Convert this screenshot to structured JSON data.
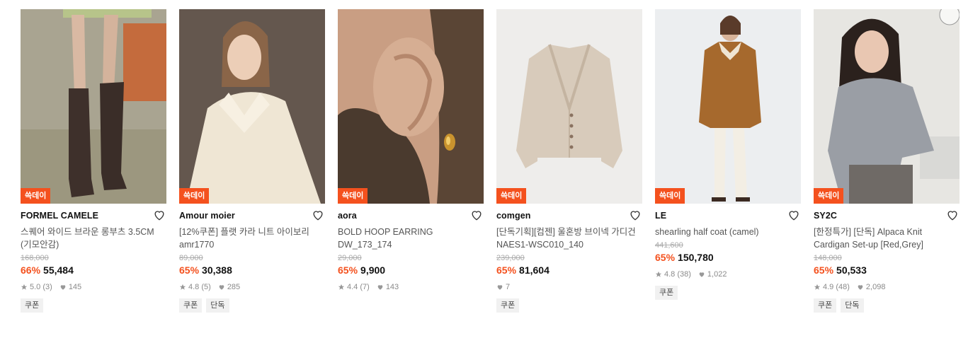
{
  "products": [
    {
      "badge": "쓱데이",
      "brand": "FORMEL CAMELE",
      "name": "스퀘어 와이드 브라운 롱부츠 3.5CM (기모안감)",
      "original_price": "168,000",
      "discount": "66%",
      "price": "55,484",
      "rating": "5.0",
      "reviews": "(3)",
      "likes": "145",
      "tags": [
        "쿠폰"
      ],
      "image_icon": "boots-photo"
    },
    {
      "badge": "쓱데이",
      "brand": "Amour moier",
      "name": "[12%쿠폰] 플랫 카라 니트 아이보리 amr1770",
      "original_price": "89,000",
      "discount": "65%",
      "price": "30,388",
      "rating": "4.8",
      "reviews": "(5)",
      "likes": "285",
      "tags": [
        "쿠폰",
        "단독"
      ],
      "image_icon": "collar-knit-photo"
    },
    {
      "badge": "쓱데이",
      "brand": "aora",
      "name": "BOLD HOOP EARRING DW_173_174",
      "original_price": "29,000",
      "discount": "65%",
      "price": "9,900",
      "rating": "4.4",
      "reviews": "(7)",
      "likes": "143",
      "tags": [],
      "image_icon": "earring-photo"
    },
    {
      "badge": "쓱데이",
      "brand": "comgen",
      "name": "[단독기획][컴젠] 울혼방 브이넥 가디건 NAES1-WSC010_140",
      "original_price": "239,000",
      "discount": "65%",
      "price": "81,604",
      "rating": "",
      "reviews": "",
      "likes": "7",
      "tags": [
        "쿠폰"
      ],
      "image_icon": "cardigan-photo"
    },
    {
      "badge": "쓱데이",
      "brand": "LE",
      "name": "shearling half coat (camel)",
      "original_price": "441,600",
      "discount": "65%",
      "price": "150,780",
      "rating": "4.8",
      "reviews": "(38)",
      "likes": "1,022",
      "tags": [
        "쿠폰"
      ],
      "image_icon": "coat-photo"
    },
    {
      "badge": "쓱데이",
      "brand": "SY2C",
      "name": "[한정특가] [단독] Alpaca Knit Cardigan Set-up [Red,Grey]",
      "original_price": "148,000",
      "discount": "65%",
      "price": "50,533",
      "rating": "4.9",
      "reviews": "(48)",
      "likes": "2,098",
      "tags": [
        "쿠폰",
        "단독"
      ],
      "image_icon": "knit-setup-photo"
    }
  ],
  "colors": {
    "accent": "#f4511e",
    "strike": "#aaaaaa",
    "tag_bg": "#f1f1f1"
  }
}
